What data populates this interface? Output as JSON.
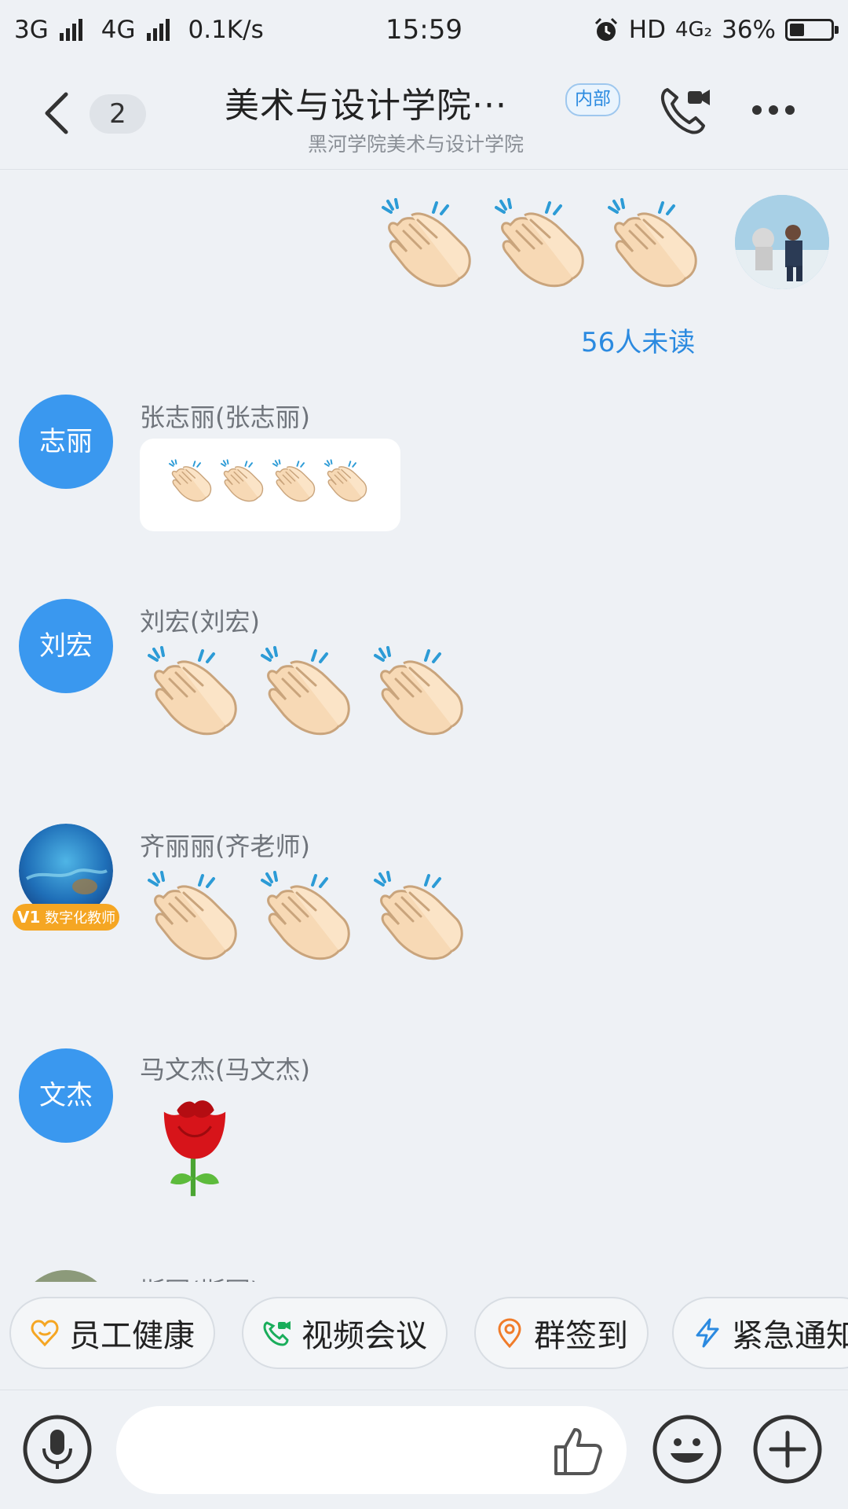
{
  "status_bar": {
    "network1": "3G",
    "network2": "4G",
    "speed": "0.1K/s",
    "time": "15:59",
    "hd": "HD",
    "network3": "4G₂",
    "battery": "36%",
    "battery_level": 0.36
  },
  "header": {
    "badge_count": "2",
    "title": "美术与设计学院···",
    "tag": "内部",
    "subtitle": "黑河学院美术与设计学院"
  },
  "messages": {
    "self": {
      "unread": "56人未读",
      "clap_count": 3
    },
    "items": [
      {
        "avatar_text": "志丽",
        "sender": "张志丽(张志丽)"
      },
      {
        "avatar_text": "刘宏",
        "sender": "刘宏(刘宏)"
      },
      {
        "avatar_text": "",
        "sender": "齐丽丽(齐老师)",
        "badge": "数字化教师",
        "badge_level": "V1"
      },
      {
        "avatar_text": "文杰",
        "sender": "马文杰(马文杰)"
      },
      {
        "avatar_text": "",
        "sender": "斯军(斯军)"
      }
    ]
  },
  "quick_actions": [
    {
      "label": "员工健康",
      "icon": "heart-smile-icon",
      "color": "#f5a623"
    },
    {
      "label": "视频会议",
      "icon": "video-call-icon",
      "color": "#1aad5b"
    },
    {
      "label": "群签到",
      "icon": "location-pin-icon",
      "color": "#f07c2a"
    },
    {
      "label": "紧急通知",
      "icon": "lightning-icon",
      "color": "#2b8ae0"
    }
  ],
  "colors": {
    "accent": "#2b8ae0",
    "avatar_blue": "#3a98ef",
    "background": "#eef1f5"
  }
}
